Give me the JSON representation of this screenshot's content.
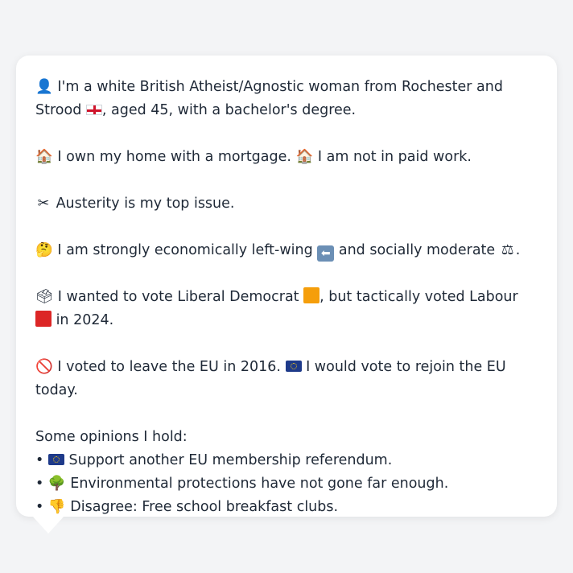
{
  "profile": {
    "intro": {
      "icon": "person-silhouette-icon",
      "text_before_flag": " I'm a white British Atheist/Agnostic woman from Rochester and Strood ",
      "flag": "england-flag-icon",
      "text_after_flag": ", aged 45, with a bachelor's degree."
    },
    "home": {
      "icon1": "house-icon",
      "text1": " I own my home with a mortgage. ",
      "icon2": "house-icon",
      "text2": " I am not in paid work."
    },
    "issue": {
      "icon": "scissors-icon",
      "text": " Austerity is my top issue."
    },
    "ideology": {
      "icon": "thinking-face-icon",
      "text1": " I am strongly economically left-wing ",
      "arrow_icon": "left-arrow-icon",
      "text2": " and socially moderate ",
      "scales_icon": "balance-scale-icon",
      "text3": "."
    },
    "vote": {
      "icon": "ballot-box-icon",
      "text1": " I wanted to vote Liberal Democrat ",
      "libdem_color": "#f59e0b",
      "text2": ", but tactically voted Labour ",
      "labour_color": "#dc2626",
      "text3": " in 2024."
    },
    "eu": {
      "icon": "prohibited-icon",
      "text1": " I voted to leave the EU in 2016. ",
      "eu_flag": "eu-flag-icon",
      "text2": " I would vote to rejoin the EU today."
    },
    "opinions_heading": "Some opinions I hold:",
    "opinions": [
      {
        "bullet": "•",
        "icon": "eu-flag-icon",
        "text": " Support another EU membership referendum."
      },
      {
        "bullet": "•",
        "icon": "tree-icon",
        "text": " Environmental protections have not gone far enough."
      },
      {
        "bullet": "•",
        "icon": "thumbs-down-icon",
        "text": " Disagree: Free school breakfast clubs."
      }
    ]
  }
}
